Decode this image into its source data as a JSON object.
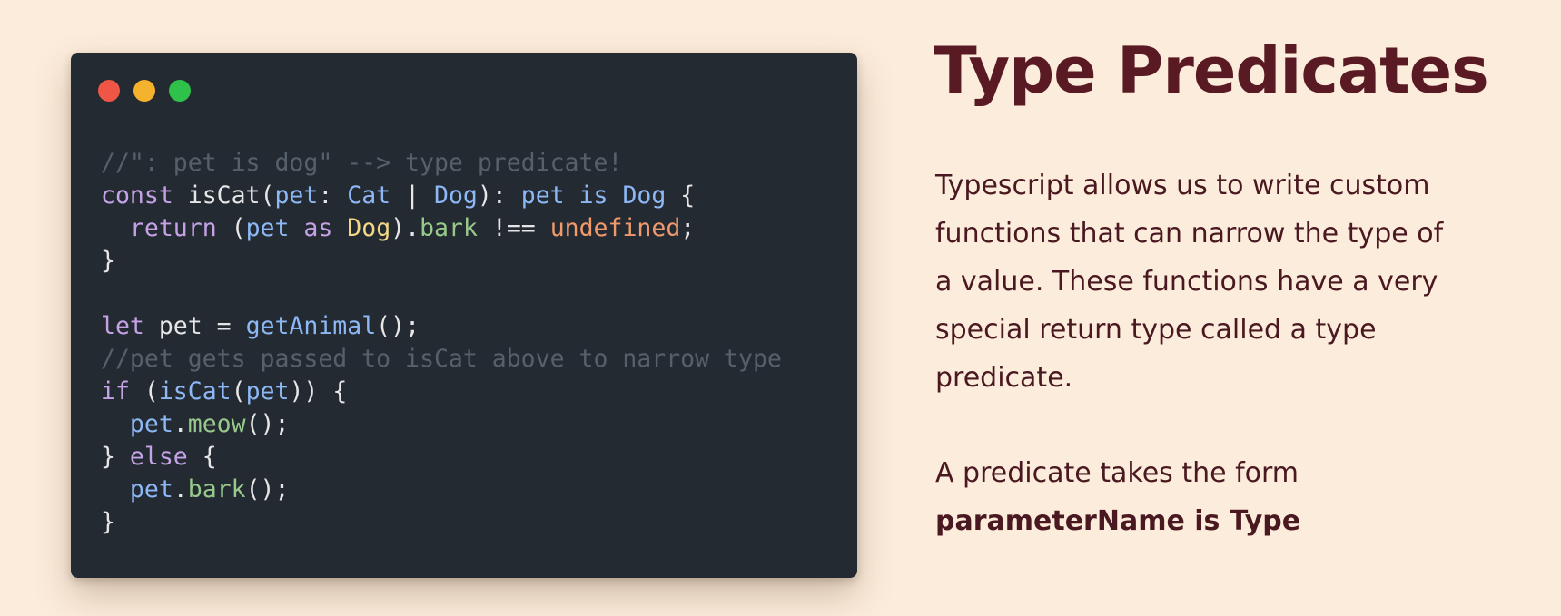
{
  "slide": {
    "title": "Type Predicates",
    "description_lines": [
      "Typescript allows us to write custom",
      "functions that can narrow the type of",
      "a value.  These functions have a very",
      "special return type called a type",
      "predicate."
    ],
    "predicate_intro": "A predicate takes the form",
    "predicate_form": "parameterName is Type"
  },
  "code_window": {
    "traffic_lights": [
      "close-dot",
      "minimize-dot",
      "maximize-dot"
    ],
    "lines": [
      [
        {
          "t": "//\": pet is dog\" --> type predicate!",
          "c": "comment"
        }
      ],
      [
        {
          "t": "const ",
          "c": "kw"
        },
        {
          "t": "isCat(",
          "c": "plain"
        },
        {
          "t": "pet",
          "c": "param"
        },
        {
          "t": ": ",
          "c": "plain"
        },
        {
          "t": "Cat",
          "c": "type"
        },
        {
          "t": " | ",
          "c": "plain"
        },
        {
          "t": "Dog",
          "c": "type"
        },
        {
          "t": "): ",
          "c": "plain"
        },
        {
          "t": "pet",
          "c": "param"
        },
        {
          "t": " is ",
          "c": "type"
        },
        {
          "t": "Dog",
          "c": "type"
        },
        {
          "t": " {",
          "c": "plain"
        }
      ],
      [
        {
          "t": "  ",
          "c": "plain"
        },
        {
          "t": "return",
          "c": "kw"
        },
        {
          "t": " (",
          "c": "plain"
        },
        {
          "t": "pet",
          "c": "param"
        },
        {
          "t": " as ",
          "c": "kw"
        },
        {
          "t": "Dog",
          "c": "cls"
        },
        {
          "t": ").",
          "c": "plain"
        },
        {
          "t": "bark",
          "c": "prop"
        },
        {
          "t": " !== ",
          "c": "plain"
        },
        {
          "t": "undefined",
          "c": "undef"
        },
        {
          "t": ";",
          "c": "plain"
        }
      ],
      [
        {
          "t": "}",
          "c": "plain"
        }
      ],
      [
        {
          "t": "",
          "c": "plain"
        }
      ],
      [
        {
          "t": "let",
          "c": "kw"
        },
        {
          "t": " pet = ",
          "c": "plain"
        },
        {
          "t": "getAnimal",
          "c": "fn"
        },
        {
          "t": "();",
          "c": "plain"
        }
      ],
      [
        {
          "t": "//pet gets passed to isCat above to narrow type",
          "c": "comment"
        }
      ],
      [
        {
          "t": "if",
          "c": "kw"
        },
        {
          "t": " (",
          "c": "plain"
        },
        {
          "t": "isCat",
          "c": "fn"
        },
        {
          "t": "(",
          "c": "plain"
        },
        {
          "t": "pet",
          "c": "param"
        },
        {
          "t": ")) {",
          "c": "plain"
        }
      ],
      [
        {
          "t": "  ",
          "c": "plain"
        },
        {
          "t": "pet",
          "c": "param"
        },
        {
          "t": ".",
          "c": "plain"
        },
        {
          "t": "meow",
          "c": "prop"
        },
        {
          "t": "();",
          "c": "plain"
        }
      ],
      [
        {
          "t": "} ",
          "c": "plain"
        },
        {
          "t": "else",
          "c": "kw"
        },
        {
          "t": " {",
          "c": "plain"
        }
      ],
      [
        {
          "t": "  ",
          "c": "plain"
        },
        {
          "t": "pet",
          "c": "param"
        },
        {
          "t": ".",
          "c": "plain"
        },
        {
          "t": "bark",
          "c": "prop"
        },
        {
          "t": "();",
          "c": "plain"
        }
      ],
      [
        {
          "t": "}",
          "c": "plain"
        }
      ]
    ]
  },
  "colors": {
    "background": "#fcecdb",
    "code_background": "#232a32",
    "title": "#5a1a24",
    "body_text": "#4a1820"
  }
}
